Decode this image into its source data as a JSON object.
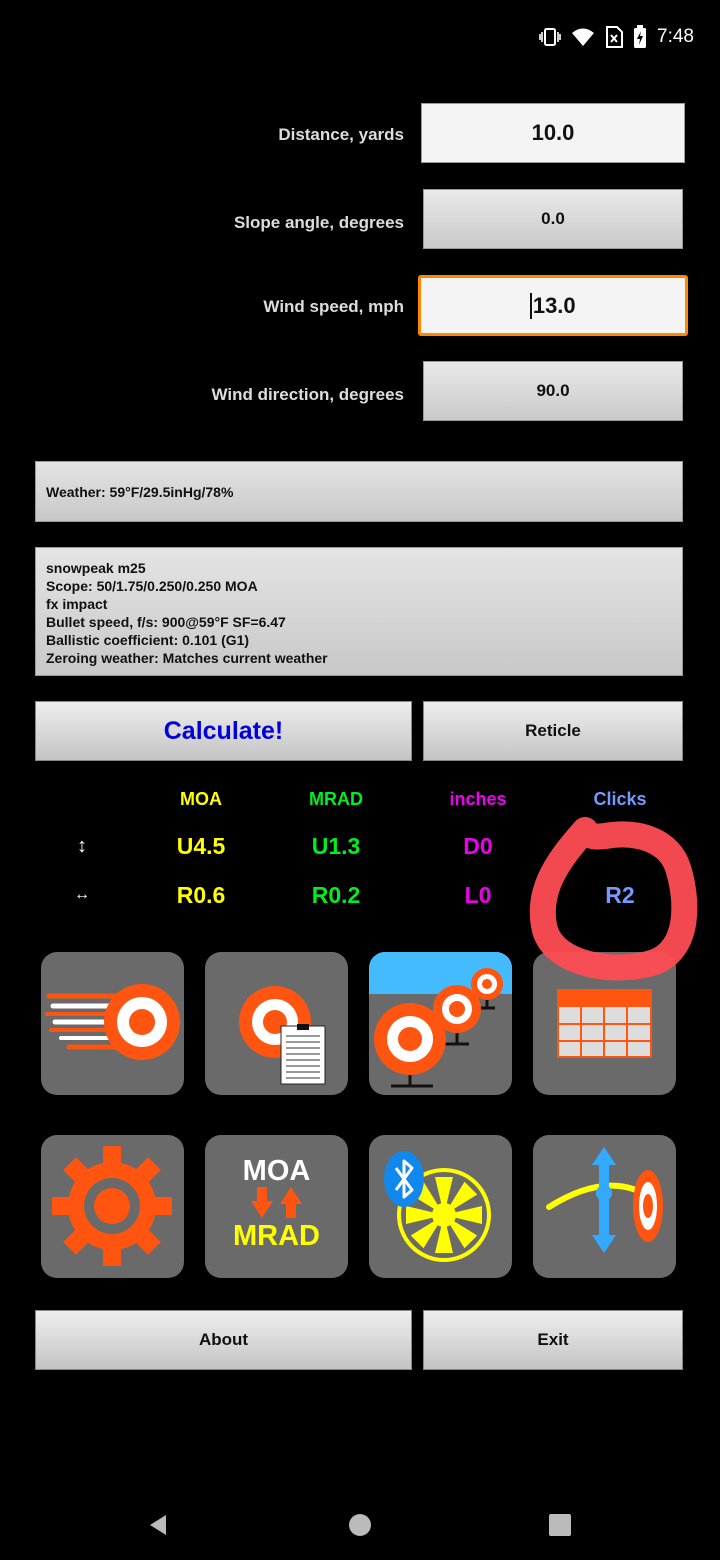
{
  "status": {
    "time": "7:48"
  },
  "fields": [
    {
      "label": "Distance, yards",
      "value": "10.0"
    },
    {
      "label": "Slope angle, degrees",
      "value": "0.0"
    },
    {
      "label": "Wind speed, mph",
      "value": "13.0"
    },
    {
      "label": "Wind direction, degrees",
      "value": "90.0"
    }
  ],
  "weather": "Weather: 59°F/29.5inHg/78%",
  "profile": [
    "snowpeak m25",
    "Scope: 50/1.75/0.250/0.250 MOA",
    "fx impact",
    "Bullet speed, f/s: 900@59°F SF=6.47",
    "Ballistic coefficient: 0.101 (G1)",
    "Zeroing weather: Matches current weather"
  ],
  "buttons": {
    "calculate": "Calculate!",
    "reticle": "Reticle",
    "about": "About",
    "exit": "Exit"
  },
  "results": {
    "headers": [
      "MOA",
      "MRAD",
      "inches",
      "Clicks"
    ],
    "vertical": [
      "U4.5",
      "U1.3",
      "D0",
      ""
    ],
    "horizontal": [
      "R0.6",
      "R0.2",
      "L0",
      "R2"
    ],
    "vertical_icon": "↕",
    "horizontal_icon": "↔"
  },
  "tiles": {
    "converter_top": "MOA",
    "converter_bottom": "MRAD"
  },
  "colors": {
    "moa": "#ffff00",
    "mrad": "#00ee22",
    "inches": "#ee00ee",
    "clicks": "#7799ff",
    "accent": "#ff5511",
    "calc_text": "#0000dd",
    "focus": "#ff8800",
    "highlight": "#ff4d55"
  }
}
